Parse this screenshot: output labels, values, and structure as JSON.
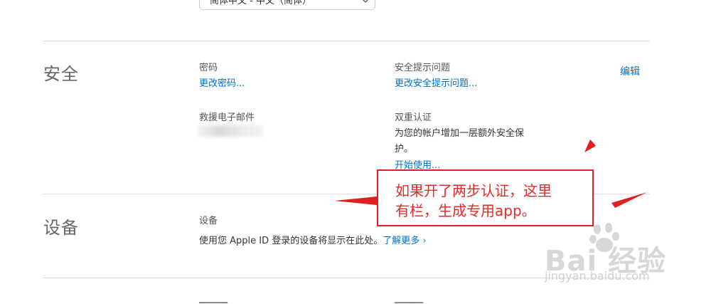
{
  "language": {
    "value": "简体中文 - 中文（简体）"
  },
  "security": {
    "title": "安全",
    "password": {
      "label": "密码",
      "link": "更改密码..."
    },
    "question": {
      "label": "安全提示问题",
      "link": "更改安全提示问题..."
    },
    "edit": "编辑",
    "rescue_email": {
      "label": "救援电子邮件"
    },
    "two_factor": {
      "label": "双重认证",
      "desc1": "为您的帐户增加一层额外安全保",
      "desc2": "护。",
      "link": "开始使用..."
    }
  },
  "devices": {
    "title": "设备",
    "label": "设备",
    "desc": "使用您 Apple ID 登录的设备将显示在此处。",
    "link": "了解更多",
    "link_chevron": "›"
  },
  "annotation": {
    "line1": "如果开了两步认证，这里",
    "line2": "有栏，生成专用app。",
    "color": "#e42a2a"
  },
  "watermark": {
    "logo": "Bai 经验",
    "url": "jingyan.baidu.com"
  },
  "colors": {
    "link": "#0070c9",
    "divider": "#dedede",
    "title": "#666666"
  }
}
